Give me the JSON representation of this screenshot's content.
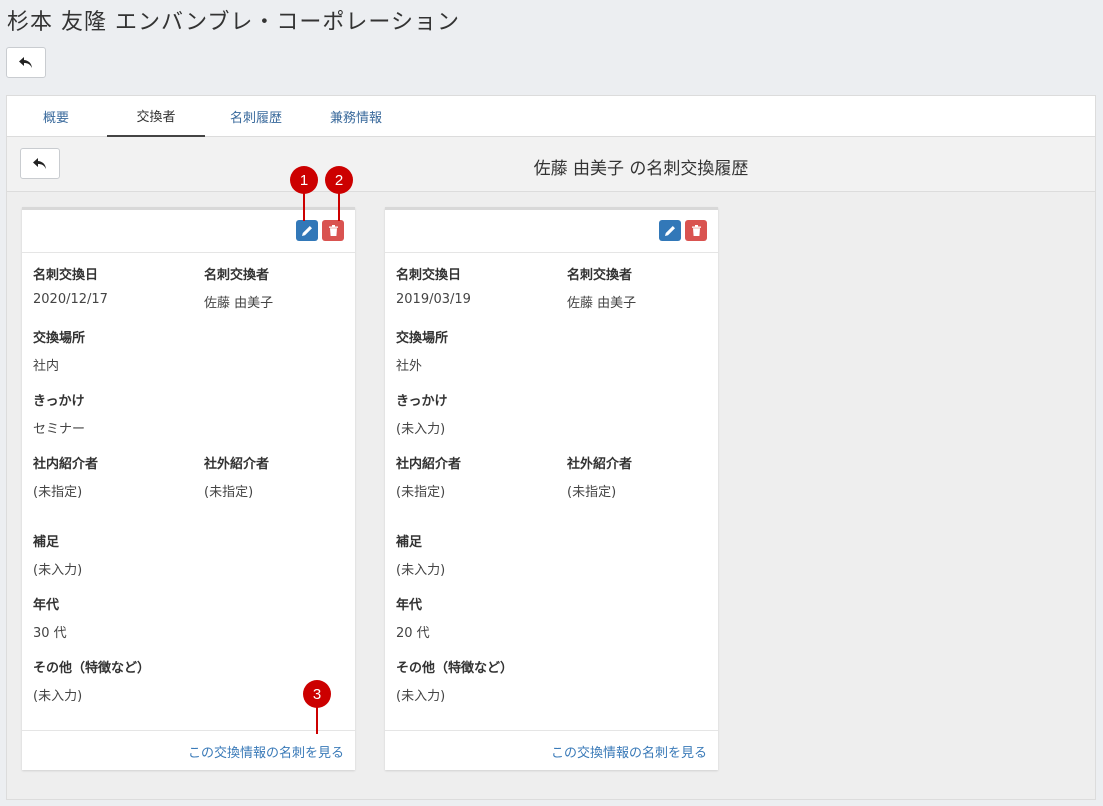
{
  "page": {
    "title": "杉本 友隆 エンバンブレ・コーポレーション"
  },
  "tabs": [
    {
      "label": "概要"
    },
    {
      "label": "交換者"
    },
    {
      "label": "名刺履歴"
    },
    {
      "label": "兼務情報"
    }
  ],
  "subheader": {
    "title": "佐藤 由美子 の名刺交換履歴"
  },
  "labels": {
    "date": "名刺交換日",
    "exchanger": "名刺交換者",
    "place": "交換場所",
    "reason": "きっかけ",
    "internal_intro": "社内紹介者",
    "external_intro": "社外紹介者",
    "note": "補足",
    "age": "年代",
    "other": "その他（特徴など）"
  },
  "cards": [
    {
      "date": "2020/12/17",
      "exchanger": "佐藤 由美子",
      "place": "社内",
      "reason": "セミナー",
      "internal_intro": "(未指定)",
      "external_intro": "(未指定)",
      "note": "(未入力)",
      "age": "30 代",
      "other": "(未入力)",
      "link": "この交換情報の名刺を見る"
    },
    {
      "date": "2019/03/19",
      "exchanger": "佐藤 由美子",
      "place": "社外",
      "reason": "(未入力)",
      "internal_intro": "(未指定)",
      "external_intro": "(未指定)",
      "note": "(未入力)",
      "age": "20 代",
      "other": "(未入力)",
      "link": "この交換情報の名刺を見る"
    }
  ],
  "callouts": [
    "1",
    "2",
    "3"
  ],
  "colors": {
    "edit_button": "#3278b8",
    "delete_button": "#d95350",
    "link": "#3a7ab8",
    "callout": "#cc0000"
  },
  "icons": {
    "back": "reply-arrow-icon",
    "edit": "pencil-icon",
    "delete": "trash-icon"
  }
}
